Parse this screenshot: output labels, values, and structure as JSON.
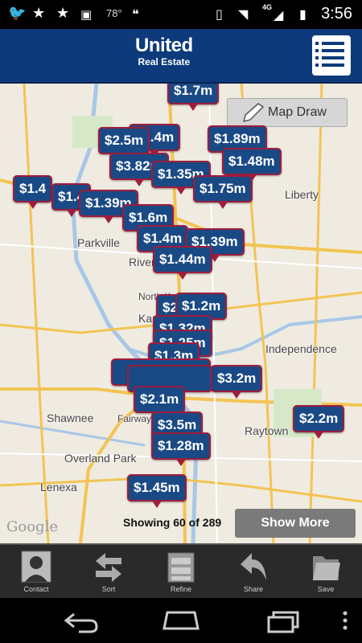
{
  "status_bar": {
    "temperature": "78°",
    "network": "4G",
    "time": "3:56"
  },
  "header": {
    "logo_line1": "United",
    "logo_line2": "Real Estate",
    "brand_color": "#0c3a7a"
  },
  "map": {
    "map_draw_label": "Map Draw",
    "attribution": "Google",
    "places": [
      "Parkville",
      "Riverside",
      "North Kansas City",
      "Kansas City",
      "Liberty",
      "Independence",
      "Shawnee",
      "Fairway",
      "Raytown",
      "Overland Park",
      "Lenexa"
    ],
    "price_pins": [
      "$1.7m",
      "$1.4m",
      "$2.5m",
      "$1.89m",
      "$1.48m",
      "$3.82m",
      "$1.35m",
      "$1.4",
      "$1.75m",
      "$1.4",
      "$1.39m",
      "$1.6m",
      "$1.4m",
      "$1.39m",
      "$1.44m",
      "$2m",
      "$1.2m",
      "$1.32m",
      "$1.25m",
      "$1.3m",
      "$3.2m",
      "$2.1m",
      "$2.2m",
      "$3.5m",
      "$1.28m",
      "$1.45m"
    ],
    "showing_text": "Showing 60 of 289",
    "show_more_label": "Show More"
  },
  "toolbar": {
    "contact": "Contact",
    "sort": "Sort",
    "refine": "Refine",
    "share": "Share",
    "save": "Save"
  }
}
